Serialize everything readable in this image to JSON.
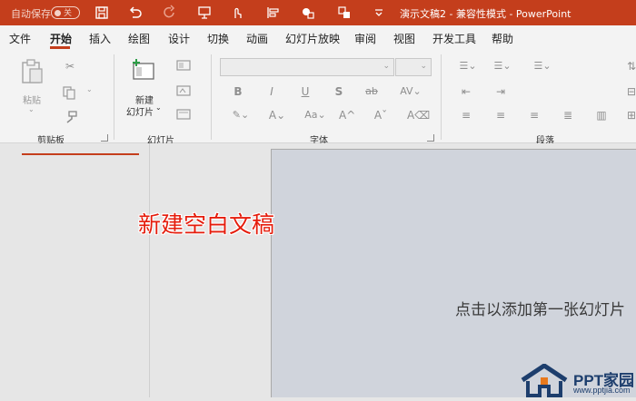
{
  "titlebar": {
    "autosave_label": "自动保存",
    "autosave_state": "关",
    "doc_title": "演示文稿2  -  兼容性模式  -  PowerPoint"
  },
  "menu": {
    "tabs": [
      "文件",
      "开始",
      "插入",
      "绘图",
      "设计",
      "切换",
      "动画",
      "幻灯片放映",
      "审阅",
      "视图",
      "开发工具",
      "帮助"
    ],
    "active_tab": "开始"
  },
  "ribbon": {
    "clipboard": {
      "paste_label": "粘贴",
      "group_label": "剪贴板"
    },
    "slides": {
      "new_slide_line1": "新建",
      "new_slide_line2": "幻灯片",
      "group_label": "幻灯片"
    },
    "font": {
      "group_label": "字体",
      "font_name": "",
      "font_size": ""
    },
    "paragraph": {
      "group_label": "段落"
    }
  },
  "workspace": {
    "slide_placeholder": "点击以添加第一张幻灯片",
    "annotation": "新建空白文稿"
  },
  "watermark": {
    "brand": "PPT家园",
    "url": "www.pptjia.com"
  },
  "colors": {
    "accent": "#c43e1c",
    "annotation": "#e51c0c",
    "slide_bg": "#d0d4dc"
  }
}
